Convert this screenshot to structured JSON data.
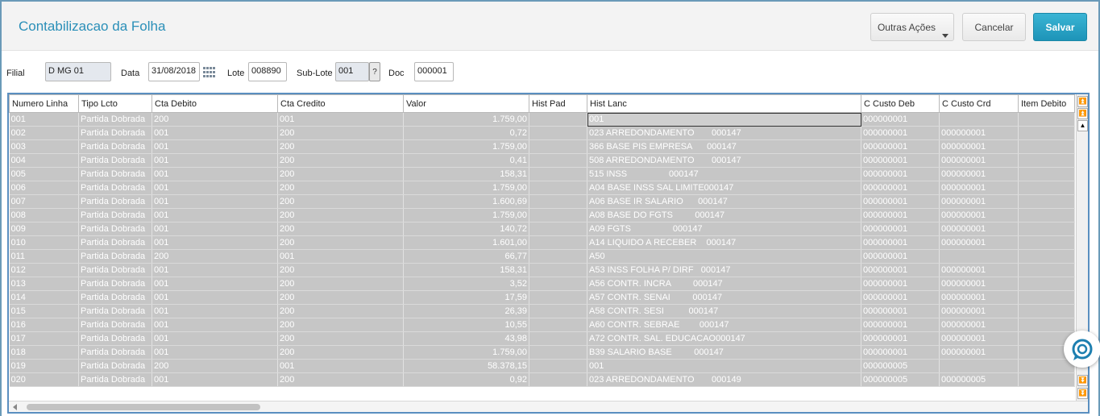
{
  "header": {
    "title": "Contabilizacao da Folha",
    "btn_outras": "Outras Ações",
    "btn_cancelar": "Cancelar",
    "btn_salvar": "Salvar",
    "accent_color": "#2a8fb8"
  },
  "filters": {
    "filial_label": "Filial",
    "filial_value": "D MG 01",
    "data_label": "Data",
    "data_value": "31/08/2018",
    "lote_label": "Lote",
    "lote_value": "008890",
    "sublote_label": "Sub-Lote",
    "sublote_value": "001",
    "sublote_btn": "?",
    "doc_label": "Doc",
    "doc_value": "000001"
  },
  "grid": {
    "columns": [
      "Numero Linha",
      "Tipo Lcto",
      "Cta Debito",
      "Cta Credito",
      "Valor",
      "Hist Pad",
      "Hist Lanc",
      "C Custo Deb",
      "C Custo Crd",
      "Item Debito"
    ],
    "rows": [
      [
        "001",
        "Partida Dobrada",
        "200",
        "001",
        "1.759,00",
        "",
        "001",
        "000000001",
        "",
        ""
      ],
      [
        "002",
        "Partida Dobrada",
        "001",
        "200",
        "0,72",
        "",
        "023 ARREDONDAMENTO       000147",
        "000000001",
        "000000001",
        ""
      ],
      [
        "003",
        "Partida Dobrada",
        "001",
        "200",
        "1.759,00",
        "",
        "366 BASE PIS EMPRESA      000147",
        "000000001",
        "000000001",
        ""
      ],
      [
        "004",
        "Partida Dobrada",
        "001",
        "200",
        "0,41",
        "",
        "508 ARREDONDAMENTO       000147",
        "000000001",
        "000000001",
        ""
      ],
      [
        "005",
        "Partida Dobrada",
        "001",
        "200",
        "158,31",
        "",
        "515 INSS                 000147",
        "000000001",
        "000000001",
        ""
      ],
      [
        "006",
        "Partida Dobrada",
        "001",
        "200",
        "1.759,00",
        "",
        "A04 BASE INSS SAL LIMITE000147",
        "000000001",
        "000000001",
        ""
      ],
      [
        "007",
        "Partida Dobrada",
        "001",
        "200",
        "1.600,69",
        "",
        "A06 BASE IR SALARIO      000147",
        "000000001",
        "000000001",
        ""
      ],
      [
        "008",
        "Partida Dobrada",
        "001",
        "200",
        "1.759,00",
        "",
        "A08 BASE DO FGTS         000147",
        "000000001",
        "000000001",
        ""
      ],
      [
        "009",
        "Partida Dobrada",
        "001",
        "200",
        "140,72",
        "",
        "A09 FGTS                 000147",
        "000000001",
        "000000001",
        ""
      ],
      [
        "010",
        "Partida Dobrada",
        "001",
        "200",
        "1.601,00",
        "",
        "A14 LIQUIDO A RECEBER    000147",
        "000000001",
        "000000001",
        ""
      ],
      [
        "011",
        "Partida Dobrada",
        "200",
        "001",
        "66,77",
        "",
        "A50",
        "000000001",
        "",
        ""
      ],
      [
        "012",
        "Partida Dobrada",
        "001",
        "200",
        "158,31",
        "",
        "A53 INSS FOLHA P/ DIRF   000147",
        "000000001",
        "000000001",
        ""
      ],
      [
        "013",
        "Partida Dobrada",
        "001",
        "200",
        "3,52",
        "",
        "A56 CONTR. INCRA         000147",
        "000000001",
        "000000001",
        ""
      ],
      [
        "014",
        "Partida Dobrada",
        "001",
        "200",
        "17,59",
        "",
        "A57 CONTR. SENAI         000147",
        "000000001",
        "000000001",
        ""
      ],
      [
        "015",
        "Partida Dobrada",
        "001",
        "200",
        "26,39",
        "",
        "A58 CONTR. SESI          000147",
        "000000001",
        "000000001",
        ""
      ],
      [
        "016",
        "Partida Dobrada",
        "001",
        "200",
        "10,55",
        "",
        "A60 CONTR. SEBRAE        000147",
        "000000001",
        "000000001",
        ""
      ],
      [
        "017",
        "Partida Dobrada",
        "001",
        "200",
        "43,98",
        "",
        "A72 CONTR. SAL. EDUCACAO000147",
        "000000001",
        "000000001",
        ""
      ],
      [
        "018",
        "Partida Dobrada",
        "001",
        "200",
        "1.759,00",
        "",
        "B39 SALARIO BASE         000147",
        "000000001",
        "000000001",
        ""
      ],
      [
        "019",
        "Partida Dobrada",
        "200",
        "001",
        "58.378,15",
        "",
        "001",
        "000000005",
        "",
        ""
      ],
      [
        "020",
        "Partida Dobrada",
        "001",
        "200",
        "0,92",
        "",
        "023 ARREDONDAMENTO       000149",
        "000000005",
        "000000005",
        ""
      ]
    ]
  }
}
